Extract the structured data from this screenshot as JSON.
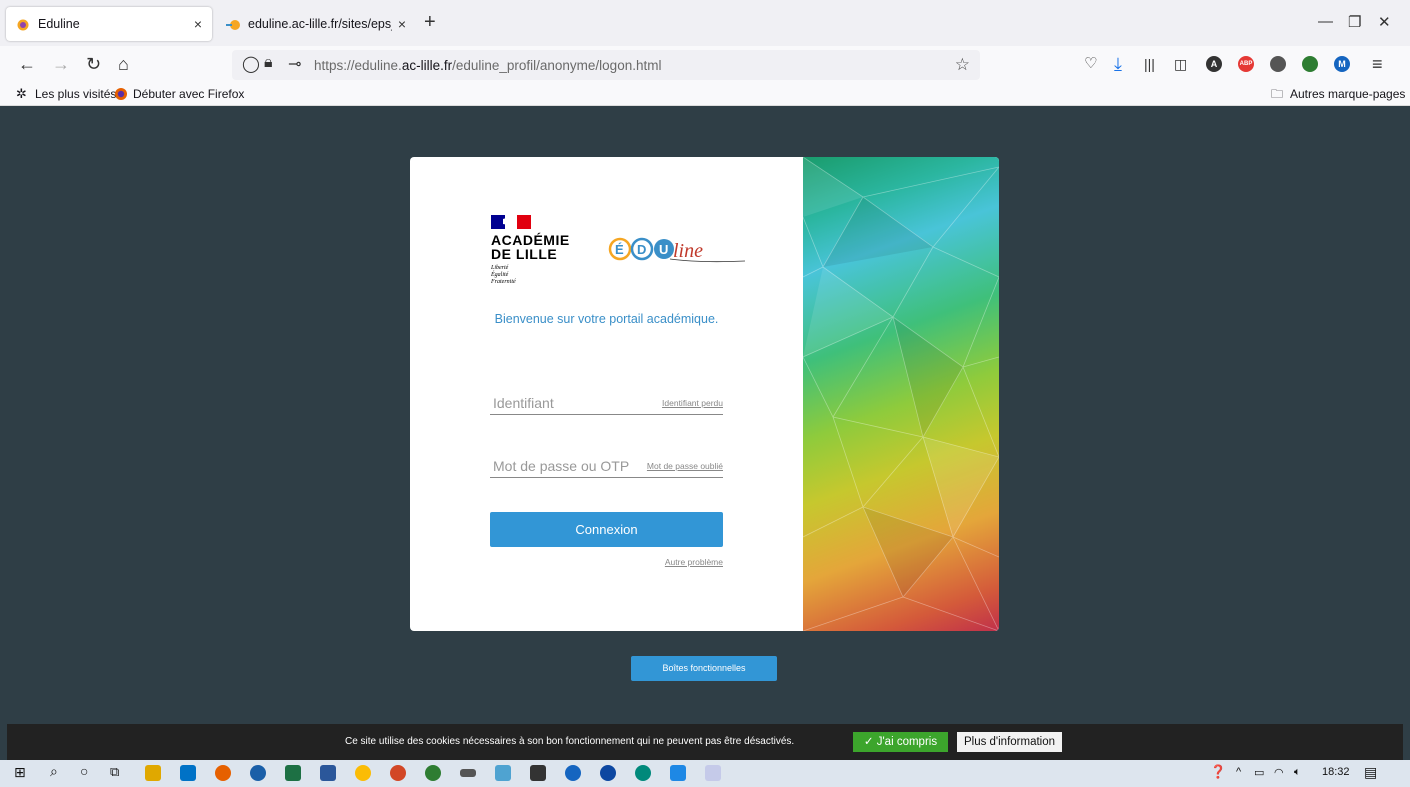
{
  "browser": {
    "tabs": [
      {
        "title": "Eduline",
        "close": "×"
      },
      {
        "title": "eduline.ac-lille.fr/sites/eps_outi",
        "close": "×"
      }
    ],
    "new_tab": "+",
    "url_prefix": "https://eduline.",
    "url_domain": "ac-lille.fr",
    "url_path": "/eduline_profil/anonyme/logon.html",
    "bookmarks": [
      "Les plus visités",
      "Débuter avec Firefox"
    ],
    "other_bookmarks": "Autres marque-pages"
  },
  "login": {
    "academie_line1": "ACADÉMIE",
    "academie_line2": "DE LILLE",
    "devise1": "Liberté",
    "devise2": "Égalité",
    "devise3": "Fraternité",
    "eduline_logo_text": "ÉDUline",
    "welcome": "Bienvenue sur votre portail académique.",
    "identifiant_placeholder": "Identifiant",
    "identifiant_perdu": "Identifiant perdu",
    "password_placeholder": "Mot de passe ou OTP",
    "password_oublie": "Mot de passe oublié",
    "connexion": "Connexion",
    "autre_probleme": "Autre problème"
  },
  "boites_fonctionnelles": "Boîtes fonctionnelles",
  "cookies": {
    "text": "Ce site utilise des cookies nécessaires à son bon fonctionnement qui ne peuvent pas être désactivés.",
    "accept": "✓ J'ai compris",
    "more": "Plus d'information"
  },
  "taskbar": {
    "time": "18:32"
  },
  "colors": {
    "page_bg": "#2f3e46",
    "button_blue": "#3296d6",
    "welcome_blue": "#3a8fc8",
    "cookie_green": "#3ca52c"
  }
}
